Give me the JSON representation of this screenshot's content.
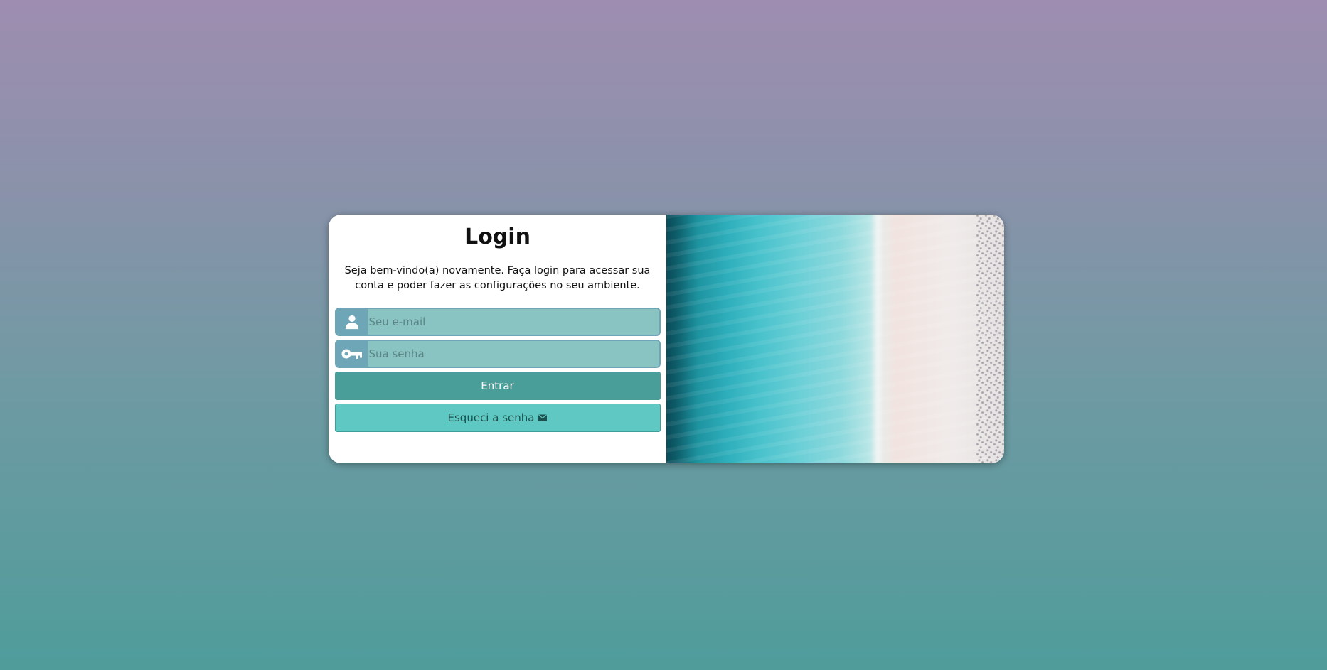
{
  "login": {
    "title": "Login",
    "subtitle": "Seja bem-vindo(a) novamente. Faça login para acessar sua conta e poder fazer as configurações no seu ambiente.",
    "email": {
      "icon": "user-icon",
      "placeholder": "Seu e-mail",
      "value": ""
    },
    "password": {
      "icon": "key-icon",
      "placeholder": "Sua senha",
      "value": ""
    },
    "submit_label": "Entrar",
    "forgot_label": "Esqueci a senha",
    "forgot_icon": "envelope-icon"
  },
  "image": {
    "description": "beach-aerial-image"
  },
  "colors": {
    "background_top": "#9e8db0",
    "background_bottom": "#4f9c9b",
    "input_bg": "#8ac4c2",
    "icon_bg": "#6fa6b7",
    "primary_button": "#4a9e9a",
    "secondary_button": "#5fc8c2"
  }
}
